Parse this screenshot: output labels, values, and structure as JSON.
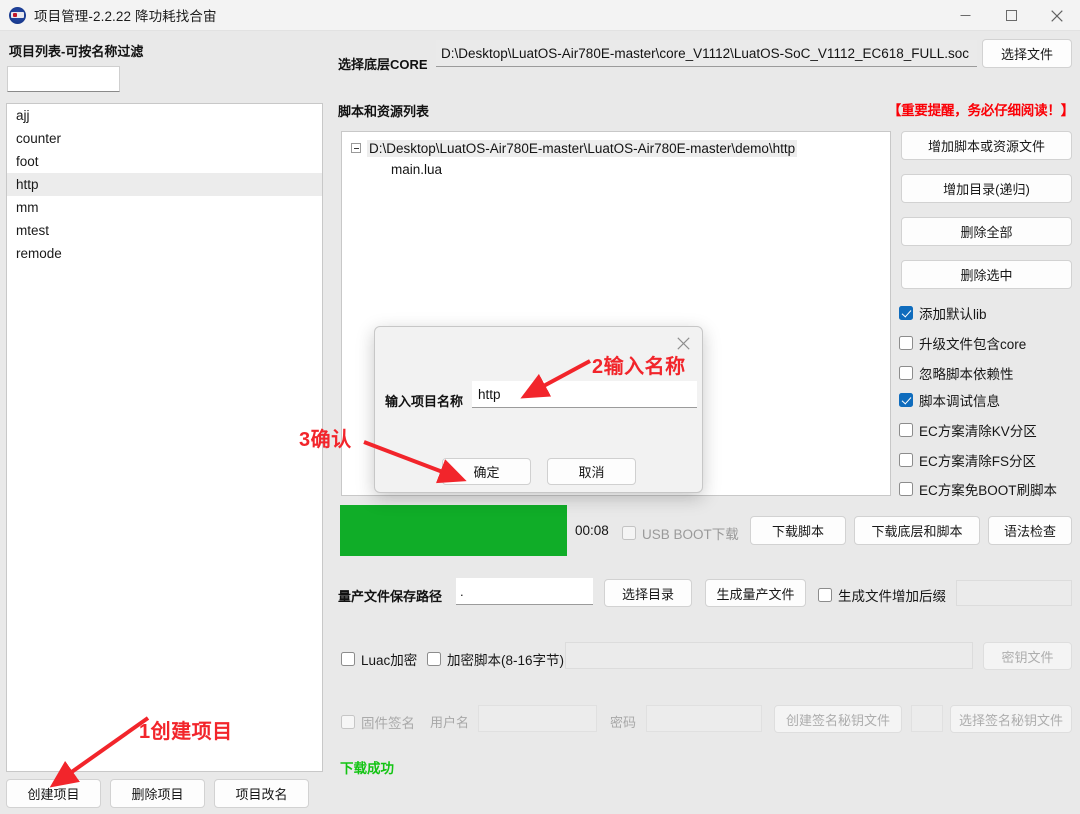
{
  "window": {
    "title": "项目管理-2.2.22 降功耗找合宙",
    "icon": "app-logo-icon",
    "minimize": "—",
    "maximize": "□",
    "close": "✕"
  },
  "left": {
    "list_label": "项目列表-可按名称过滤",
    "filter_value": "",
    "filter_placeholder": "",
    "projects": [
      "ajj",
      "counter",
      "foot",
      "http",
      "mm",
      "mtest",
      "remode"
    ],
    "selected_project": "http",
    "buttons": [
      "创建项目",
      "删除项目",
      "项目改名"
    ]
  },
  "core": {
    "label": "选择底层CORE",
    "path": "D:\\Desktop\\LuatOS-Air780E-master\\core_V1112\\LuatOS-SoC_V1112_EC618_FULL.soc",
    "choose_file_button": "选择文件"
  },
  "scripts": {
    "label": "脚本和资源列表",
    "warning": "【重要提醒，务必仔细阅读！】",
    "tree_root": "D:\\Desktop\\LuatOS-Air780E-master\\LuatOS-Air780E-master\\demo\\http",
    "tree_child": "main.lua",
    "buttons": [
      "增加脚本或资源文件",
      "增加目录(递归)",
      "删除全部",
      "删除选中"
    ],
    "checkboxes": [
      {
        "label": "添加默认lib",
        "checked": true
      },
      {
        "label": "升级文件包含core",
        "checked": false
      },
      {
        "label": "忽略脚本依赖性",
        "checked": false
      },
      {
        "label": "脚本调试信息",
        "checked": true
      },
      {
        "label": "EC方案清除KV分区",
        "checked": false
      },
      {
        "label": "EC方案清除FS分区",
        "checked": false
      },
      {
        "label": "EC方案免BOOT刷脚本",
        "checked": false
      }
    ]
  },
  "progress": {
    "fill_color": "#10ad28",
    "percent": 100,
    "timer": "00:08",
    "usb_boot_label": "USB BOOT下载",
    "usb_boot_checked": false,
    "actions": [
      "下载脚本",
      "下载底层和脚本",
      "语法检查"
    ]
  },
  "massproduction": {
    "label": "量产文件保存路径",
    "path_value": ".",
    "choose_dir_button": "选择目录",
    "generate_button": "生成量产文件",
    "suffix_label": "生成文件增加后缀",
    "suffix_checked": false,
    "suffix_value": ""
  },
  "encryption": {
    "luac_label": "Luac加密",
    "luac_checked": false,
    "script_label": "加密脚本(8-16字节)",
    "script_checked": false,
    "key_value": "",
    "key_file_button": "密钥文件"
  },
  "signature": {
    "label": "固件签名",
    "checked": false,
    "username_label": "用户名",
    "username_value": "",
    "password_label": "密码",
    "password_value": "",
    "create_key_button": "创建签名秘钥文件",
    "select_key_button": "选择签名秘钥文件"
  },
  "status": {
    "text": "下载成功",
    "color": "#13c413"
  },
  "modal": {
    "close": "✕",
    "field_label": "输入项目名称",
    "input_value": "http",
    "ok_button": "确定",
    "cancel_button": "取消"
  },
  "annotations": {
    "step1": "1创建项目",
    "step2": "2输入名称",
    "step3": "3确认",
    "color": "#f2252b"
  }
}
